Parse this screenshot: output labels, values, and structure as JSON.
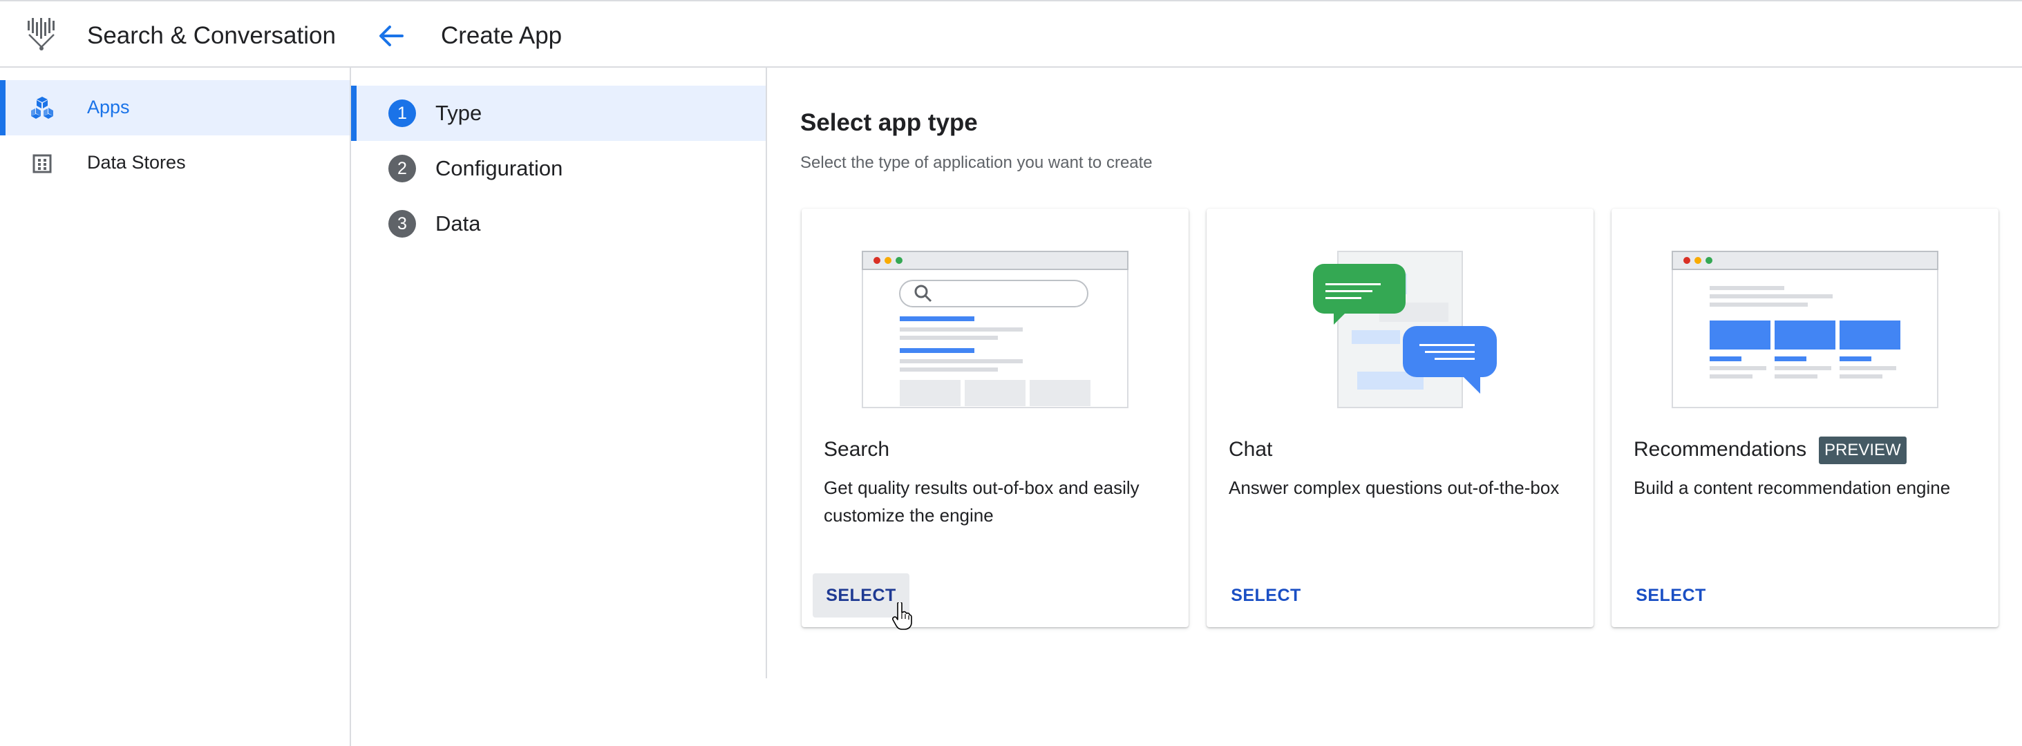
{
  "header": {
    "app_title": "Search & Conversation",
    "page_title": "Create App",
    "logo_icon": "search-conversation-logo-icon",
    "back_icon": "arrow-left-icon"
  },
  "sidebar": {
    "items": [
      {
        "label": "Apps",
        "icon": "cubes-icon",
        "active": true
      },
      {
        "label": "Data Stores",
        "icon": "building-grid-icon",
        "active": false
      }
    ]
  },
  "stepper": {
    "steps": [
      {
        "number": "1",
        "label": "Type",
        "active": true
      },
      {
        "number": "2",
        "label": "Configuration",
        "active": false
      },
      {
        "number": "3",
        "label": "Data",
        "active": false
      }
    ]
  },
  "main": {
    "title": "Select app type",
    "subtitle": "Select the type of application you want to create",
    "cards": [
      {
        "title": "Search",
        "description": "Get quality results out-of-box and easily customize the engine",
        "button": "SELECT",
        "badge": ""
      },
      {
        "title": "Chat",
        "description": "Answer complex questions out-of-the-box",
        "button": "SELECT",
        "badge": ""
      },
      {
        "title": "Recommendations",
        "description": "Build a content recommendation engine",
        "button": "SELECT",
        "badge": "PREVIEW"
      }
    ]
  },
  "colors": {
    "accent": "#1a73e8",
    "active_bg": "#e8f0fe",
    "chat_green": "#34a853",
    "badge_bg": "#455a64"
  }
}
